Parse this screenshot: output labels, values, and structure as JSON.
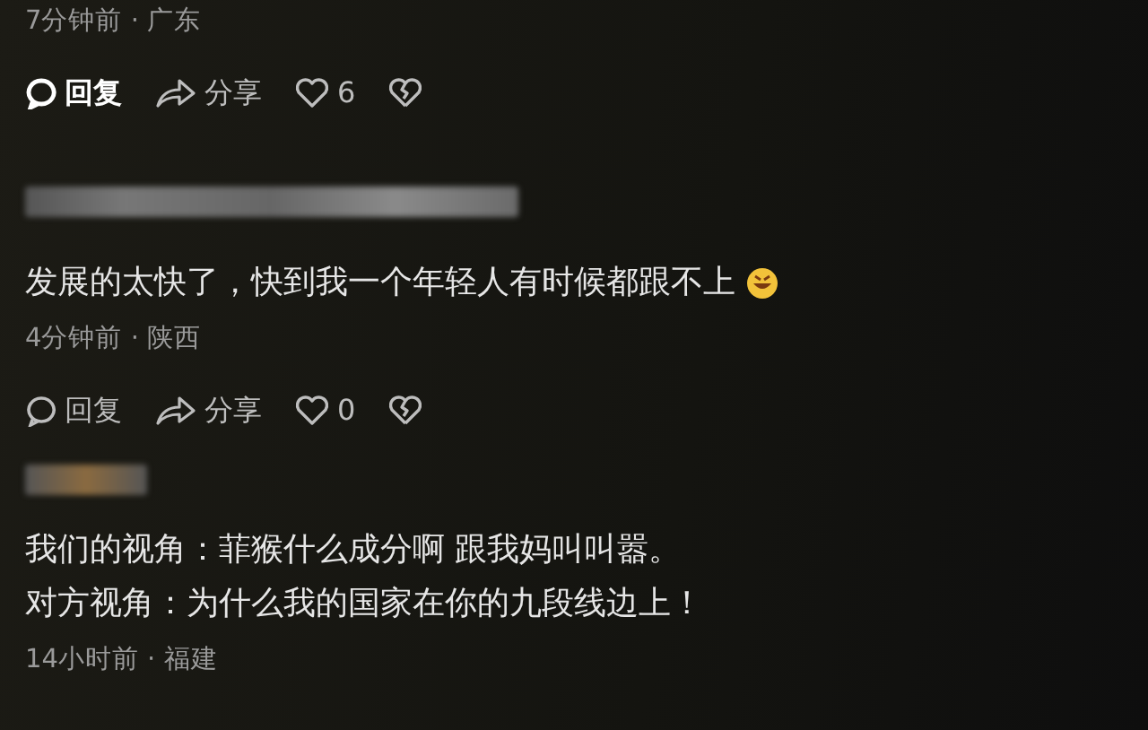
{
  "comments": [
    {
      "has_name": false,
      "trailing_emoji": false,
      "meta": "7分钟前 · 广东",
      "reply": {
        "label": "回复",
        "highlighted": true
      },
      "share": "分享",
      "likes": "6"
    },
    {
      "has_name": true,
      "lines": [
        "发展的太快了，快到我一个年轻人有时候都跟不上"
      ],
      "trailing_emoji": true,
      "meta": "4分钟前 · 陕西",
      "reply": {
        "label": "回复",
        "highlighted": false
      },
      "share": "分享",
      "likes": "0"
    },
    {
      "has_name": true,
      "lines": [
        "我们的视角：菲猴什么成分啊 跟我妈叫叫嚣。",
        "对方视角：为什么我的国家在你的九段线边上！"
      ],
      "trailing_emoji": false,
      "meta": "14小时前 · 福建"
    }
  ]
}
